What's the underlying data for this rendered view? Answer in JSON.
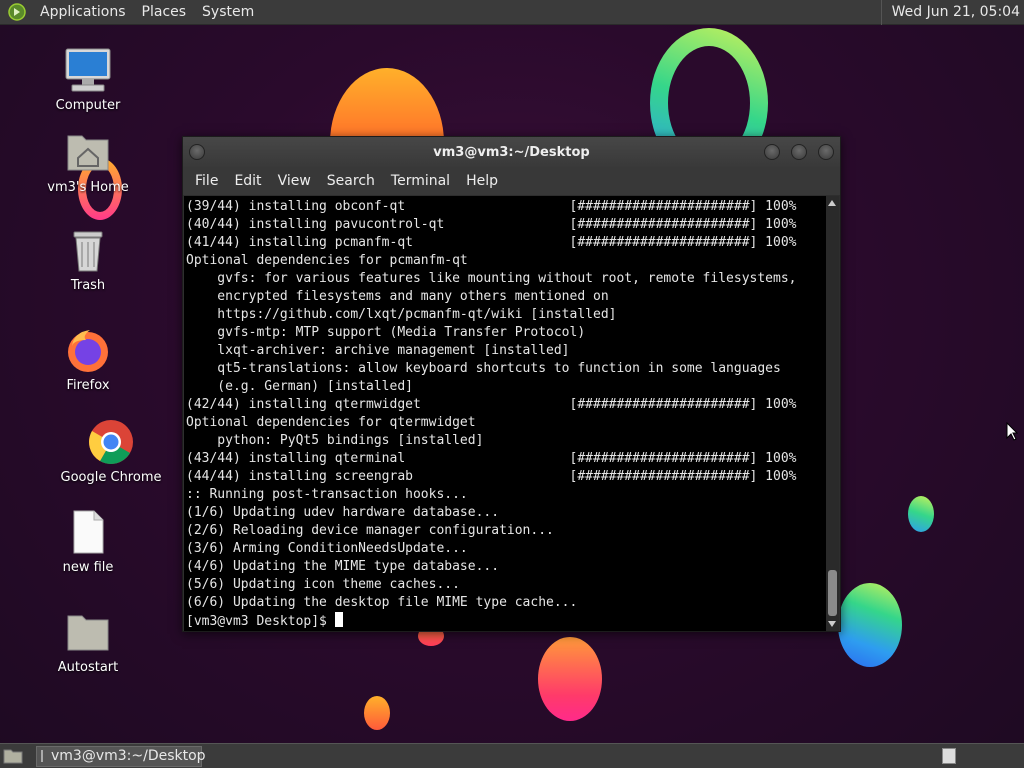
{
  "top_panel": {
    "menus": [
      "Applications",
      "Places",
      "System"
    ],
    "clock": "Wed Jun 21, 05:04"
  },
  "desktop_icons": [
    {
      "label": "Computer",
      "icon": "computer-icon"
    },
    {
      "label": "vm3's Home",
      "icon": "home-folder-icon"
    },
    {
      "label": "Trash",
      "icon": "trash-icon"
    },
    {
      "label": "Firefox",
      "icon": "firefox-icon"
    },
    {
      "label": "Google Chrome",
      "icon": "chrome-icon"
    },
    {
      "label": "new file",
      "icon": "file-icon"
    },
    {
      "label": "Autostart",
      "icon": "folder-icon"
    }
  ],
  "terminal": {
    "title": "vm3@vm3:~/Desktop",
    "menu": [
      "File",
      "Edit",
      "View",
      "Search",
      "Terminal",
      "Help"
    ],
    "lines": [
      "(39/44) installing obconf-qt                     [######################] 100%",
      "(40/44) installing pavucontrol-qt                [######################] 100%",
      "(41/44) installing pcmanfm-qt                    [######################] 100%",
      "Optional dependencies for pcmanfm-qt",
      "    gvfs: for various features like mounting without root, remote filesystems,",
      "    encrypted filesystems and many others mentioned on",
      "    https://github.com/lxqt/pcmanfm-qt/wiki [installed]",
      "    gvfs-mtp: MTP support (Media Transfer Protocol)",
      "    lxqt-archiver: archive management [installed]",
      "    qt5-translations: allow keyboard shortcuts to function in some languages",
      "    (e.g. German) [installed]",
      "(42/44) installing qtermwidget                   [######################] 100%",
      "Optional dependencies for qtermwidget",
      "    python: PyQt5 bindings [installed]",
      "(43/44) installing qterminal                     [######################] 100%",
      "(44/44) installing screengrab                    [######################] 100%",
      ":: Running post-transaction hooks...",
      "(1/6) Updating udev hardware database...",
      "(2/6) Reloading device manager configuration...",
      "(3/6) Arming ConditionNeedsUpdate...",
      "(4/6) Updating the MIME type database...",
      "(5/6) Updating icon theme caches...",
      "(6/6) Updating the desktop file MIME type cache..."
    ],
    "prompt": "[vm3@vm3 Desktop]$ "
  },
  "taskbar": {
    "task_label": "vm3@vm3:~/Desktop"
  }
}
